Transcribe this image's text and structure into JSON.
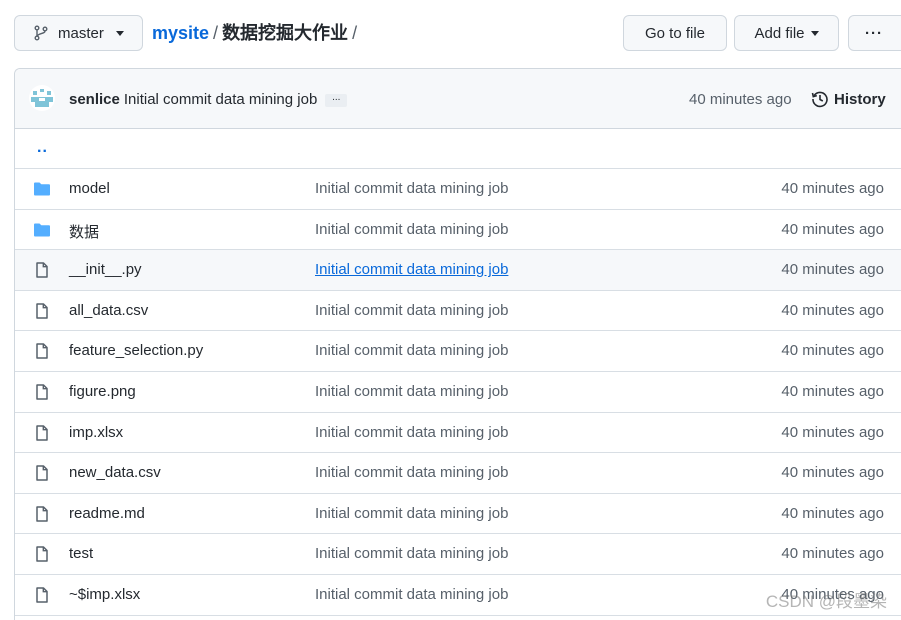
{
  "branch": {
    "name": "master",
    "icon": "git-branch-icon"
  },
  "breadcrumb": {
    "repo": "mysite",
    "separator": "/",
    "directory": "数据挖掘大作业",
    "trailing": "/"
  },
  "actions": {
    "goto_file": "Go to file",
    "add_file": "Add file",
    "more": "···"
  },
  "commit": {
    "author": "senlice",
    "message": "Initial commit data mining job",
    "ellipsis": "...",
    "time": "40 minutes ago",
    "history_label": "History"
  },
  "up_dir": "..",
  "files": [
    {
      "name": "model",
      "type": "folder",
      "message": "Initial commit data mining job",
      "time": "40 minutes ago"
    },
    {
      "name": "数据",
      "type": "folder",
      "message": "Initial commit data mining job",
      "time": "40 minutes ago"
    },
    {
      "name": "__init__.py",
      "type": "file",
      "message": "Initial commit data mining job",
      "time": "40 minutes ago",
      "hovered": true
    },
    {
      "name": "all_data.csv",
      "type": "file",
      "message": "Initial commit data mining job",
      "time": "40 minutes ago"
    },
    {
      "name": "feature_selection.py",
      "type": "file",
      "message": "Initial commit data mining job",
      "time": "40 minutes ago"
    },
    {
      "name": "figure.png",
      "type": "file",
      "message": "Initial commit data mining job",
      "time": "40 minutes ago"
    },
    {
      "name": "imp.xlsx",
      "type": "file",
      "message": "Initial commit data mining job",
      "time": "40 minutes ago"
    },
    {
      "name": "new_data.csv",
      "type": "file",
      "message": "Initial commit data mining job",
      "time": "40 minutes ago"
    },
    {
      "name": "readme.md",
      "type": "file",
      "message": "Initial commit data mining job",
      "time": "40 minutes ago"
    },
    {
      "name": "test",
      "type": "file",
      "message": "Initial commit data mining job",
      "time": "40 minutes ago"
    },
    {
      "name": "~$imp.xlsx",
      "type": "file",
      "message": "Initial commit data mining job",
      "time": "40 minutes ago"
    }
  ],
  "watermark": "CSDN @段墨染",
  "colors": {
    "link": "#0969da",
    "folder": "#54aeff",
    "muted": "#57606a",
    "border": "#d0d7de"
  }
}
